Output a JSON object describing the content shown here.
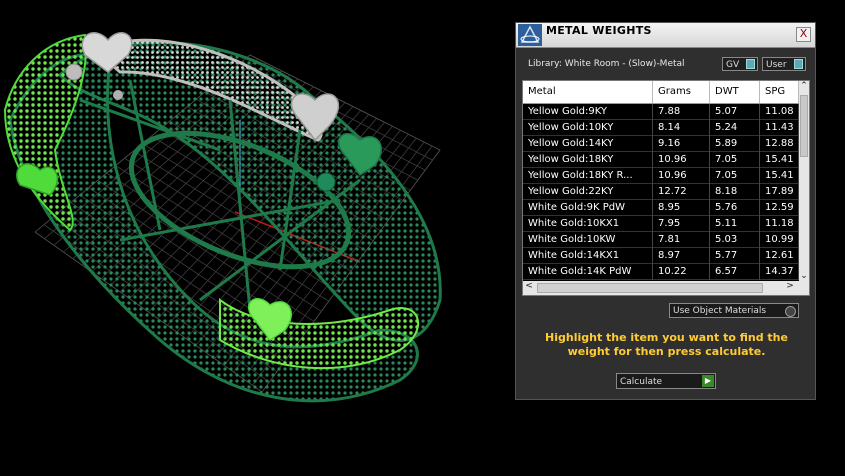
{
  "panel": {
    "title": "METAL WEIGHTS",
    "close_label": "X",
    "library_text": "Library: White Room - (Slow)-Metal",
    "gv_toggle_label": "GV",
    "user_toggle_label": "User",
    "columns": [
      "Metal",
      "Grams",
      "DWT",
      "SPG"
    ],
    "rows": [
      [
        "Yellow Gold:9KY",
        "7.88",
        "5.07",
        "11.08"
      ],
      [
        "Yellow Gold:10KY",
        "8.14",
        "5.24",
        "11.43"
      ],
      [
        "Yellow Gold:14KY",
        "9.16",
        "5.89",
        "12.88"
      ],
      [
        "Yellow Gold:18KY",
        "10.96",
        "7.05",
        "15.41"
      ],
      [
        "Yellow Gold:18KY R...",
        "10.96",
        "7.05",
        "15.41"
      ],
      [
        "Yellow Gold:22KY",
        "12.72",
        "8.18",
        "17.89"
      ],
      [
        "White Gold:9K PdW",
        "8.95",
        "5.76",
        "12.59"
      ],
      [
        "White Gold:10KX1",
        "7.95",
        "5.11",
        "11.18"
      ],
      [
        "White Gold:10KW",
        "7.81",
        "5.03",
        "10.99"
      ],
      [
        "White Gold:14KX1",
        "8.97",
        "5.77",
        "12.61"
      ],
      [
        "White Gold:14K PdW",
        "10.22",
        "6.57",
        "14.37"
      ]
    ],
    "use_object_materials_label": "Use Object Materials",
    "hint_text": "Highlight the item you want to find the weight for then press calculate.",
    "calculate_label": "Calculate"
  },
  "colors": {
    "hint": "#ffcc33",
    "ring_dark": "#1f7a4a",
    "ring_light": "#4fdc3a",
    "ring_silver": "#c0c0c0"
  },
  "icons": [
    "app-logo-icon",
    "close-icon",
    "scroll-up-icon",
    "scroll-down-icon",
    "scroll-left-icon",
    "scroll-right-icon",
    "play-arrow-icon"
  ]
}
